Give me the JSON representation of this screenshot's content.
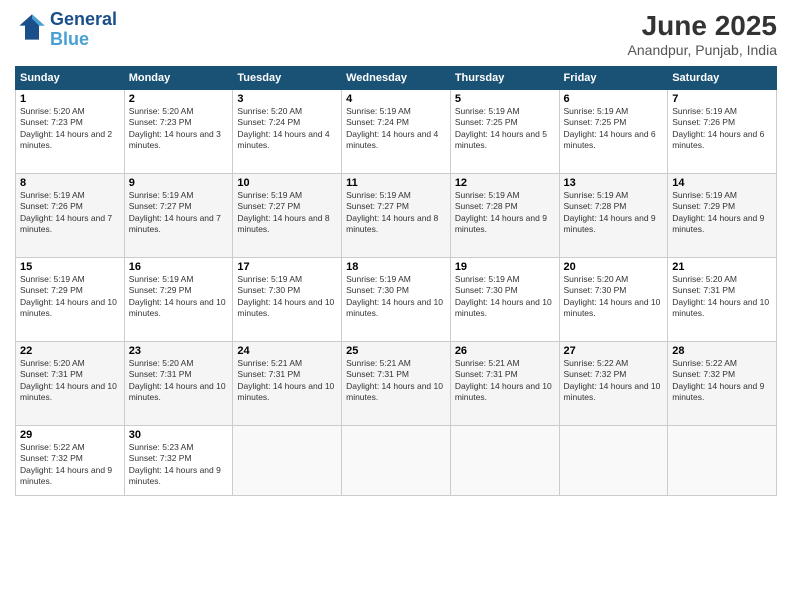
{
  "logo": {
    "line1": "General",
    "line2": "Blue"
  },
  "title": "June 2025",
  "subtitle": "Anandpur, Punjab, India",
  "days_header": [
    "Sunday",
    "Monday",
    "Tuesday",
    "Wednesday",
    "Thursday",
    "Friday",
    "Saturday"
  ],
  "weeks": [
    [
      {
        "num": "1",
        "sunrise": "5:20 AM",
        "sunset": "7:23 PM",
        "daylight": "14 hours and 2 minutes."
      },
      {
        "num": "2",
        "sunrise": "5:20 AM",
        "sunset": "7:23 PM",
        "daylight": "14 hours and 3 minutes."
      },
      {
        "num": "3",
        "sunrise": "5:20 AM",
        "sunset": "7:24 PM",
        "daylight": "14 hours and 4 minutes."
      },
      {
        "num": "4",
        "sunrise": "5:19 AM",
        "sunset": "7:24 PM",
        "daylight": "14 hours and 4 minutes."
      },
      {
        "num": "5",
        "sunrise": "5:19 AM",
        "sunset": "7:25 PM",
        "daylight": "14 hours and 5 minutes."
      },
      {
        "num": "6",
        "sunrise": "5:19 AM",
        "sunset": "7:25 PM",
        "daylight": "14 hours and 6 minutes."
      },
      {
        "num": "7",
        "sunrise": "5:19 AM",
        "sunset": "7:26 PM",
        "daylight": "14 hours and 6 minutes."
      }
    ],
    [
      {
        "num": "8",
        "sunrise": "5:19 AM",
        "sunset": "7:26 PM",
        "daylight": "14 hours and 7 minutes."
      },
      {
        "num": "9",
        "sunrise": "5:19 AM",
        "sunset": "7:27 PM",
        "daylight": "14 hours and 7 minutes."
      },
      {
        "num": "10",
        "sunrise": "5:19 AM",
        "sunset": "7:27 PM",
        "daylight": "14 hours and 8 minutes."
      },
      {
        "num": "11",
        "sunrise": "5:19 AM",
        "sunset": "7:27 PM",
        "daylight": "14 hours and 8 minutes."
      },
      {
        "num": "12",
        "sunrise": "5:19 AM",
        "sunset": "7:28 PM",
        "daylight": "14 hours and 9 minutes."
      },
      {
        "num": "13",
        "sunrise": "5:19 AM",
        "sunset": "7:28 PM",
        "daylight": "14 hours and 9 minutes."
      },
      {
        "num": "14",
        "sunrise": "5:19 AM",
        "sunset": "7:29 PM",
        "daylight": "14 hours and 9 minutes."
      }
    ],
    [
      {
        "num": "15",
        "sunrise": "5:19 AM",
        "sunset": "7:29 PM",
        "daylight": "14 hours and 10 minutes."
      },
      {
        "num": "16",
        "sunrise": "5:19 AM",
        "sunset": "7:29 PM",
        "daylight": "14 hours and 10 minutes."
      },
      {
        "num": "17",
        "sunrise": "5:19 AM",
        "sunset": "7:30 PM",
        "daylight": "14 hours and 10 minutes."
      },
      {
        "num": "18",
        "sunrise": "5:19 AM",
        "sunset": "7:30 PM",
        "daylight": "14 hours and 10 minutes."
      },
      {
        "num": "19",
        "sunrise": "5:19 AM",
        "sunset": "7:30 PM",
        "daylight": "14 hours and 10 minutes."
      },
      {
        "num": "20",
        "sunrise": "5:20 AM",
        "sunset": "7:30 PM",
        "daylight": "14 hours and 10 minutes."
      },
      {
        "num": "21",
        "sunrise": "5:20 AM",
        "sunset": "7:31 PM",
        "daylight": "14 hours and 10 minutes."
      }
    ],
    [
      {
        "num": "22",
        "sunrise": "5:20 AM",
        "sunset": "7:31 PM",
        "daylight": "14 hours and 10 minutes."
      },
      {
        "num": "23",
        "sunrise": "5:20 AM",
        "sunset": "7:31 PM",
        "daylight": "14 hours and 10 minutes."
      },
      {
        "num": "24",
        "sunrise": "5:21 AM",
        "sunset": "7:31 PM",
        "daylight": "14 hours and 10 minutes."
      },
      {
        "num": "25",
        "sunrise": "5:21 AM",
        "sunset": "7:31 PM",
        "daylight": "14 hours and 10 minutes."
      },
      {
        "num": "26",
        "sunrise": "5:21 AM",
        "sunset": "7:31 PM",
        "daylight": "14 hours and 10 minutes."
      },
      {
        "num": "27",
        "sunrise": "5:22 AM",
        "sunset": "7:32 PM",
        "daylight": "14 hours and 10 minutes."
      },
      {
        "num": "28",
        "sunrise": "5:22 AM",
        "sunset": "7:32 PM",
        "daylight": "14 hours and 9 minutes."
      }
    ],
    [
      {
        "num": "29",
        "sunrise": "5:22 AM",
        "sunset": "7:32 PM",
        "daylight": "14 hours and 9 minutes."
      },
      {
        "num": "30",
        "sunrise": "5:23 AM",
        "sunset": "7:32 PM",
        "daylight": "14 hours and 9 minutes."
      },
      null,
      null,
      null,
      null,
      null
    ]
  ]
}
